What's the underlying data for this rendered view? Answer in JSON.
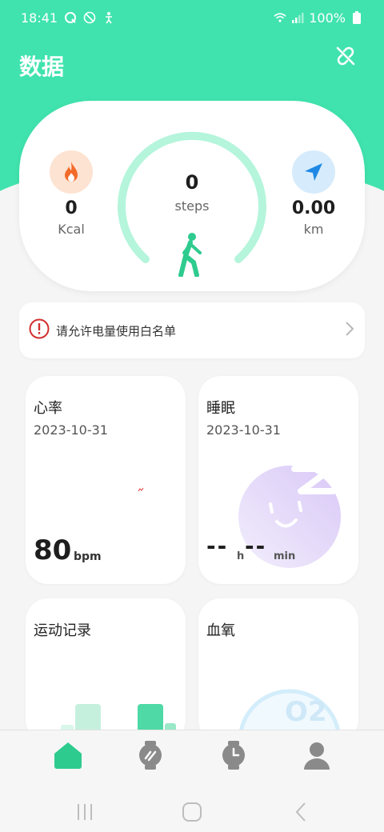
{
  "status_bar": {
    "time": "18:41",
    "battery": "100%"
  },
  "header": {
    "title": "数据"
  },
  "activity": {
    "calories": {
      "value": "0",
      "unit": "Kcal"
    },
    "steps": {
      "value": "0",
      "unit": "steps"
    },
    "distance": {
      "value": "0.00",
      "unit": "km"
    },
    "step_progress": 0
  },
  "banner": {
    "text": "请允许电量使用白名单"
  },
  "cards": {
    "heart_rate": {
      "title": "心率",
      "date": "2023-10-31",
      "value": "80",
      "unit": "bpm"
    },
    "sleep": {
      "title": "睡眠",
      "date": "2023-10-31",
      "hours": "--",
      "hours_unit": "h",
      "minutes": "--",
      "minutes_unit": "min"
    },
    "exercise": {
      "title": "运动记录"
    },
    "blood_oxygen": {
      "title": "血氧",
      "badge_text": "O2"
    }
  },
  "colors": {
    "brand_green": "#40e3ad",
    "calorie_bg": "#fde3d2",
    "calorie_icon": "#f26b2a",
    "distance_bg": "#d6ecfc",
    "distance_icon": "#1e88e5",
    "ring": "#b4f5dc",
    "alert_red": "#d32f2f"
  },
  "icons": {
    "calorie": "flame-icon",
    "distance": "navigation-arrow-icon",
    "walker": "walking-person-icon",
    "link": "unlink-icon",
    "alert": "alert-circle-icon",
    "chevron": "chevron-right-icon",
    "nav": [
      "home-icon",
      "watch-band-icon",
      "watch-face-icon",
      "user-icon"
    ]
  }
}
